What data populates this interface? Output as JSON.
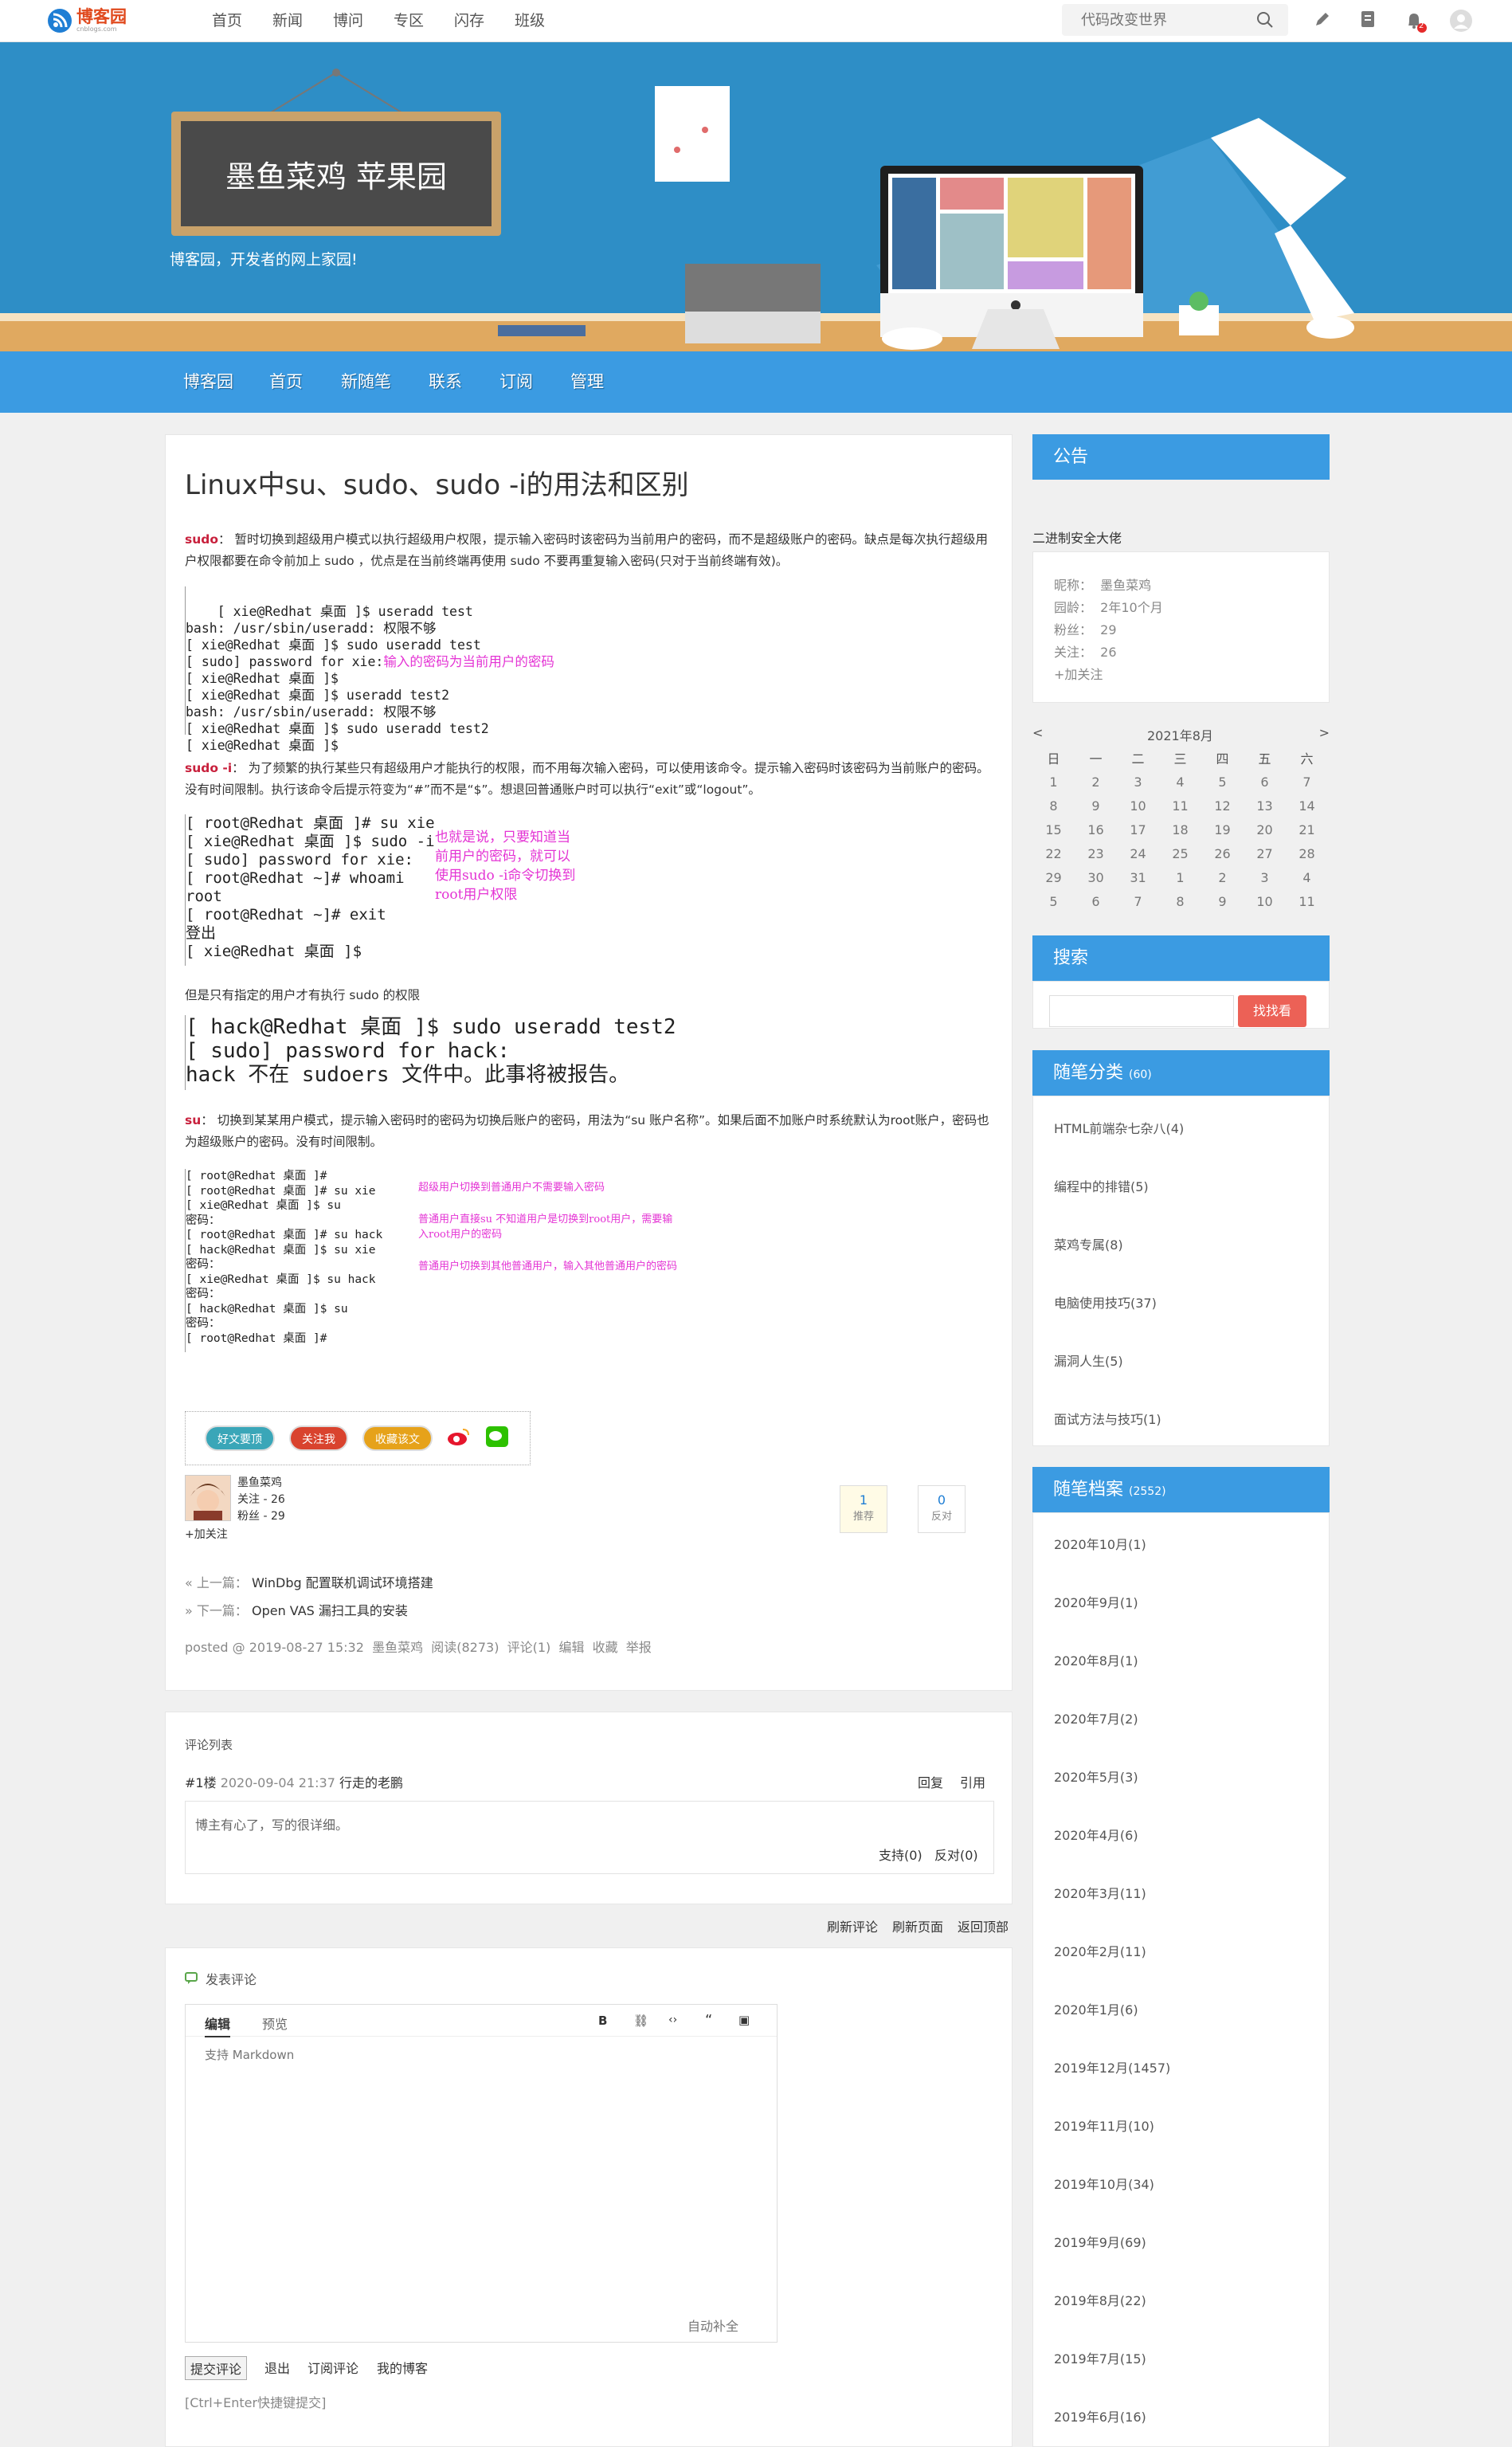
{
  "topbar": {
    "logo_text": "博客园",
    "logo_sub": "cnblogs.com",
    "nav": [
      "首页",
      "新闻",
      "博问",
      "专区",
      "闪存",
      "班级"
    ],
    "search_placeholder": "代码改变世界",
    "notif_count": "2"
  },
  "banner": {
    "blog_title": "墨鱼菜鸡 苹果园",
    "description": "博客园，开发者的网上家园!"
  },
  "menu": [
    "博客园",
    "首页",
    "新随笔",
    "联系",
    "订阅",
    "管理"
  ],
  "post": {
    "title": "Linux中su、sudo、sudo -i的用法和区别",
    "p1_label": "sudo",
    "p1": "： 暂时切换到超级用户模式以执行超级用户权限，提示输入密码时该密码为当前用户的密码，而不是超级账户的密码。缺点是每次执行超级用户权限都要在命令前加上 sudo ，优点是在当前终端再使用 sudo 不要再重复输入密码(只对于当前终端有效)。",
    "code1": "[ xie@Redhat 桌面 ]$ useradd test\nbash: /usr/sbin/useradd: 权限不够\n[ xie@Redhat 桌面 ]$ sudo useradd test\n[ sudo] password for xie:",
    "code1_ann": "输入的密码为当前用户的密码",
    "code1b": "[ xie@Redhat 桌面 ]$\n[ xie@Redhat 桌面 ]$ useradd test2\nbash: /usr/sbin/useradd: 权限不够\n[ xie@Redhat 桌面 ]$ sudo useradd test2\n[ xie@Redhat 桌面 ]$",
    "p2_label": "sudo -i",
    "p2": "： 为了频繁的执行某些只有超级用户才能执行的权限，而不用每次输入密码，可以使用该命令。提示输入密码时该密码为当前账户的密码。没有时间限制。执行该命令后提示符变为“#”而不是“$”。想退回普通账户时可以执行“exit”或“logout”。",
    "code2": "[ root@Redhat 桌面 ]# su xie\n[ xie@Redhat 桌面 ]$ sudo -i\n[ sudo] password for xie:\n[ root@Redhat ~]# whoami\nroot\n[ root@Redhat ~]# exit\n登出\n[ xie@Redhat 桌面 ]$",
    "code2_ann": "也就是说，只要知道当前用户的密码，就可以使用sudo -i命令切换到root用户权限",
    "p3": "但是只有指定的用户才有执行 sudo 的权限",
    "code3": "[ hack@Redhat 桌面 ]$ sudo useradd test2\n[ sudo] password for hack:\nhack 不在 sudoers 文件中。此事将被报告。",
    "p4_label": "su",
    "p4": "： 切换到某某用户模式，提示输入密码时的密码为切换后账户的密码，用法为“su 账户名称”。如果后面不加账户时系统默认为root账户，密码也为超级账户的密码。没有时间限制。",
    "code4": "[ root@Redhat 桌面 ]#\n[ root@Redhat 桌面 ]# su xie\n[ xie@Redhat 桌面 ]$ su\n密码：\n[ root@Redhat 桌面 ]# su hack\n[ hack@Redhat 桌面 ]$ su xie\n密码：\n[ xie@Redhat 桌面 ]$ su hack\n密码：\n[ hack@Redhat 桌面 ]$ su\n密码：\n[ root@Redhat 桌面 ]#",
    "code4_ann1": "超级用户切换到普通用户不需要输入密码",
    "code4_ann2": "普通用户直接su 不知道用户是切换到root用户，需要输入root用户的密码",
    "code4_ann3": "普通用户切换到其他普通用户，输入其他普通用户的密码",
    "share": [
      "好文要顶",
      "关注我",
      "收藏该文"
    ],
    "author_name": "墨鱼菜鸡",
    "author_follow": "关注 - 26",
    "author_fans": "粉丝 - 29",
    "add_follow": "+加关注",
    "digg_count": "1",
    "digg_label": "推荐",
    "bury_count": "0",
    "bury_label": "反对",
    "prev_label": "« 上一篇：",
    "prev_title": "WinDbg 配置联机调试环境搭建",
    "next_label": "» 下一篇：",
    "next_title": "Open VAS 漏扫工具的安装",
    "footer": "posted @ 2019-08-27 15:32  墨鱼菜鸡  阅读(8273)  评论(1)  编辑  收藏  举报"
  },
  "comments": {
    "header": "评论列表",
    "floor": "#1楼",
    "date": "2020-09-04 21:37",
    "author": "行走的老鹏",
    "reply": "回复",
    "quote": "引用",
    "body": "博主有心了，写的很详细。",
    "support": "支持(0)",
    "oppose": "反对(0)",
    "links": [
      "刷新评论",
      "刷新页面",
      "返回顶部"
    ]
  },
  "postform": {
    "title": "发表评论",
    "tab_edit": "编辑",
    "tab_preview": "预览",
    "placeholder": "支持 Markdown",
    "autocomplete": "自动补全",
    "submit": "提交评论",
    "links": [
      "退出",
      "订阅评论",
      "我的博客"
    ],
    "hint": "[Ctrl+Enter快捷键提交]"
  },
  "sidebar": {
    "notice_title": "公告",
    "notice_text": "二进制安全大佬",
    "profile": [
      "昵称：  墨鱼菜鸡",
      "园龄：  2年10个月",
      "粉丝：  29",
      "关注：  26"
    ],
    "profile_follow": "+加关注",
    "calendar_title": "2021年8月",
    "calendar_prev": "<",
    "calendar_next": ">",
    "calendar_head": [
      "日",
      "一",
      "二",
      "三",
      "四",
      "五",
      "六"
    ],
    "calendar_rows": [
      [
        "1",
        "2",
        "3",
        "4",
        "5",
        "6",
        "7"
      ],
      [
        "8",
        "9",
        "10",
        "11",
        "12",
        "13",
        "14"
      ],
      [
        "15",
        "16",
        "17",
        "18",
        "19",
        "20",
        "21"
      ],
      [
        "22",
        "23",
        "24",
        "25",
        "26",
        "27",
        "28"
      ],
      [
        "29",
        "30",
        "31",
        "1",
        "2",
        "3",
        "4"
      ],
      [
        "5",
        "6",
        "7",
        "8",
        "9",
        "10",
        "11"
      ]
    ],
    "search_title": "搜索",
    "search_button": "找找看",
    "categories_title": "随笔分类",
    "categories_count": "(60)",
    "categories": [
      "HTML前端杂七杂八(4)",
      "编程中的排错(5)",
      "菜鸡专属(8)",
      "电脑使用技巧(37)",
      "漏洞人生(5)",
      "面试方法与技巧(1)"
    ],
    "archive_title": "随笔档案",
    "archive_count": "(2552)",
    "archive": [
      "2020年10月(1)",
      "2020年9月(1)",
      "2020年8月(1)",
      "2020年7月(2)",
      "2020年5月(3)",
      "2020年4月(6)",
      "2020年3月(11)",
      "2020年2月(11)",
      "2020年1月(6)",
      "2019年12月(1457)",
      "2019年11月(10)",
      "2019年10月(34)",
      "2019年9月(69)",
      "2019年8月(22)",
      "2019年7月(15)",
      "2019年6月(16)"
    ]
  }
}
